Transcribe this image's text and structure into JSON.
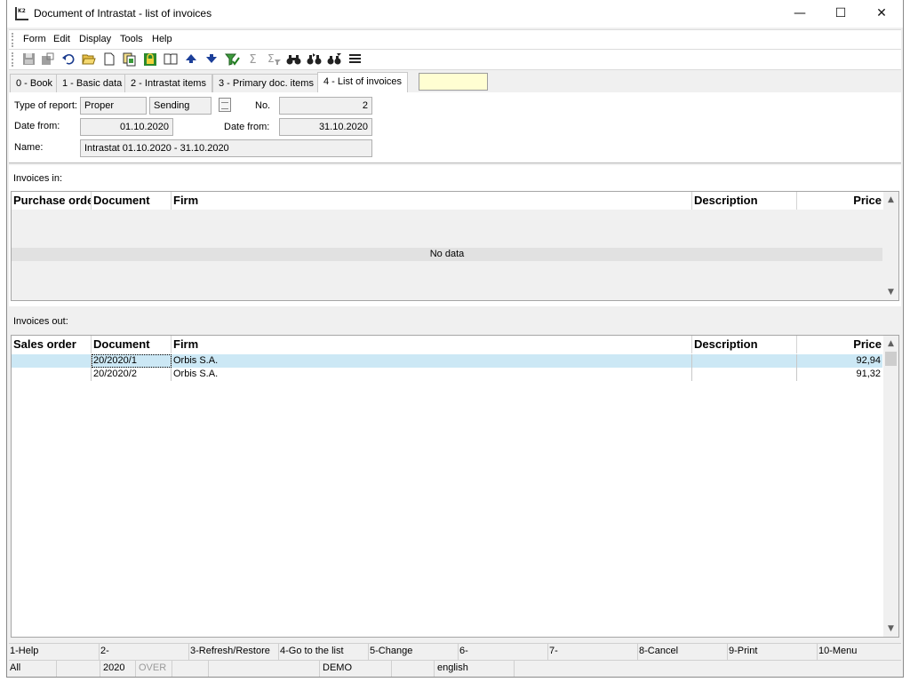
{
  "window": {
    "title": "Document of Intrastat - list of invoices",
    "minimize_glyph": "—",
    "maximize_glyph": "☐",
    "close_glyph": "✕"
  },
  "menu": [
    "Form",
    "Edit",
    "Display",
    "Tools",
    "Help"
  ],
  "toolbar": {
    "icons": [
      "save-icon",
      "save-as-icon",
      "undo-icon",
      "open-folder-icon",
      "new-document-icon",
      "copy-document-icon",
      "lock-icon",
      "book-icon",
      "arrow-up-icon",
      "arrow-down-icon",
      "filter-check-icon",
      "sum-icon",
      "sum-filter-icon",
      "binoculars-icon",
      "binoculars-next-icon",
      "binoculars-settings-icon",
      "menu-lines-icon"
    ]
  },
  "tabs": [
    {
      "label": "0 - Book"
    },
    {
      "label": "1 - Basic data"
    },
    {
      "label": "2 - Intrastat items"
    },
    {
      "label": "3 - Primary doc. items"
    },
    {
      "label": "4 - List of invoices",
      "active": true
    }
  ],
  "form": {
    "type_of_report_label": "Type of report:",
    "type_value": "Proper",
    "direction_value": "Sending",
    "no_label": "No.",
    "no_value": "2",
    "date_from_label": "Date from:",
    "date_from_value": "01.10.2020",
    "date_from2_label": "Date from:",
    "date_from2_value": "31.10.2020",
    "name_label": "Name:",
    "name_value": "Intrastat 01.10.2020 - 31.10.2020"
  },
  "invoices_in": {
    "label": "Invoices in:",
    "columns": [
      "Purchase order",
      "Document",
      "Firm",
      "Description",
      "Price"
    ],
    "empty_text": "No data"
  },
  "invoices_out": {
    "label": "Invoices out:",
    "columns": [
      "Sales order",
      "Document",
      "Firm",
      "Description",
      "Price"
    ],
    "rows": [
      {
        "order": "",
        "document": "20/2020/1",
        "firm": "Orbis S.A.",
        "description": "",
        "price": "92,94"
      },
      {
        "order": "",
        "document": "20/2020/2",
        "firm": "Orbis S.A.",
        "description": "",
        "price": "91,32"
      }
    ]
  },
  "function_keys": [
    "1-Help",
    "2-",
    "3-Refresh/Restore",
    "4-Go to the list",
    "5-Change",
    "6-",
    "7-",
    "8-Cancel",
    "9-Print",
    "10-Menu"
  ],
  "status": {
    "filter": "All",
    "year": "2020",
    "mode": "OVER",
    "database": "DEMO",
    "language": "english"
  },
  "colors": {
    "selected_row": "#cce8f5",
    "tab_box": "#fffed2"
  }
}
